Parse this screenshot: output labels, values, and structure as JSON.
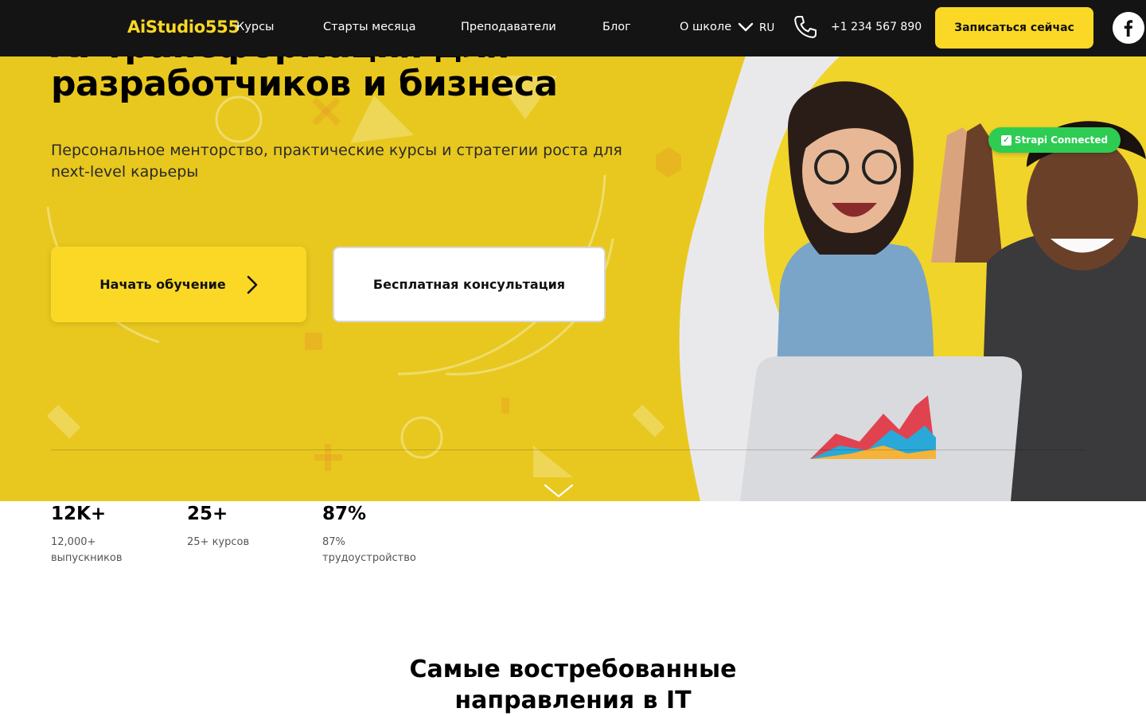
{
  "header": {
    "logo": "AiStudio555",
    "nav": [
      {
        "label": "Курсы"
      },
      {
        "label": "Старты месяца"
      },
      {
        "label": "Преподаватели"
      },
      {
        "label": "Блог"
      },
      {
        "label": "О школе"
      }
    ],
    "language": "RU",
    "phone": "+1 234 567 890",
    "cta_label": "Записаться сейчас",
    "icons": [
      "chevron-down-icon",
      "phone-icon",
      "facebook-icon"
    ]
  },
  "hero": {
    "title_line1": "AI-трансформация для",
    "title_line2": "разработчиков и бизнеса",
    "subtitle": "Персональное менторство, практические курсы и стратегии роста для next-level карьеры",
    "primary_button": "Начать обучение",
    "secondary_button": "Бесплатная консультация",
    "status_badge": "Strapi Connected"
  },
  "stats": [
    {
      "value": "12K+",
      "label": "12,000+ выпускников"
    },
    {
      "value": "25+",
      "label": "25+ курсов"
    },
    {
      "value": "87%",
      "label": "87% трудоустройство"
    }
  ],
  "section": {
    "title": "Самые востребованные направления в IT"
  },
  "colors": {
    "header_bg": "#141414",
    "accent_yellow": "#fbd825",
    "hero_bg": "#e8c81e",
    "badge_green": "#2ecc52"
  }
}
